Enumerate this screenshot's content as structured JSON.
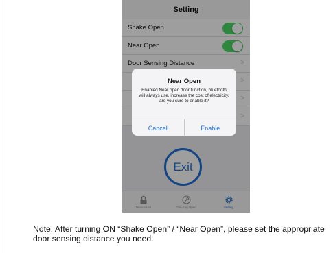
{
  "nav": {
    "title": "Setting"
  },
  "settings": {
    "rows": [
      {
        "label": "Shake Open",
        "control": "toggle",
        "on": true
      },
      {
        "label": "Near Open",
        "control": "toggle",
        "on": true
      },
      {
        "label": "Door Sensing Distance",
        "control": "chevron"
      },
      {
        "label": "",
        "control": "chevron"
      },
      {
        "label": "",
        "control": "chevron"
      },
      {
        "label": "",
        "control": "chevron"
      }
    ],
    "toggle_color": "#4cd964"
  },
  "exit": {
    "label": "Exit"
  },
  "tabs": [
    {
      "label": "Device List",
      "icon": "lock-icon",
      "active": false
    },
    {
      "label": "One Key Open",
      "icon": "key-icon",
      "active": false
    },
    {
      "label": "Setting",
      "icon": "gear-icon",
      "active": true
    }
  ],
  "dialog": {
    "title": "Near Open",
    "message": "Enabled Near open door function, bluetooth will always use, increase the cost of electricity, are you sure to enable it?",
    "cancel_label": "Cancel",
    "enable_label": "Enable"
  },
  "note": {
    "text": "Note: After turning ON “Shake Open” / “Near Open”, please set the appropriate door sensing distance you need."
  },
  "colors": {
    "accent": "#1f6fd4",
    "toggle_on": "#4cd964"
  }
}
